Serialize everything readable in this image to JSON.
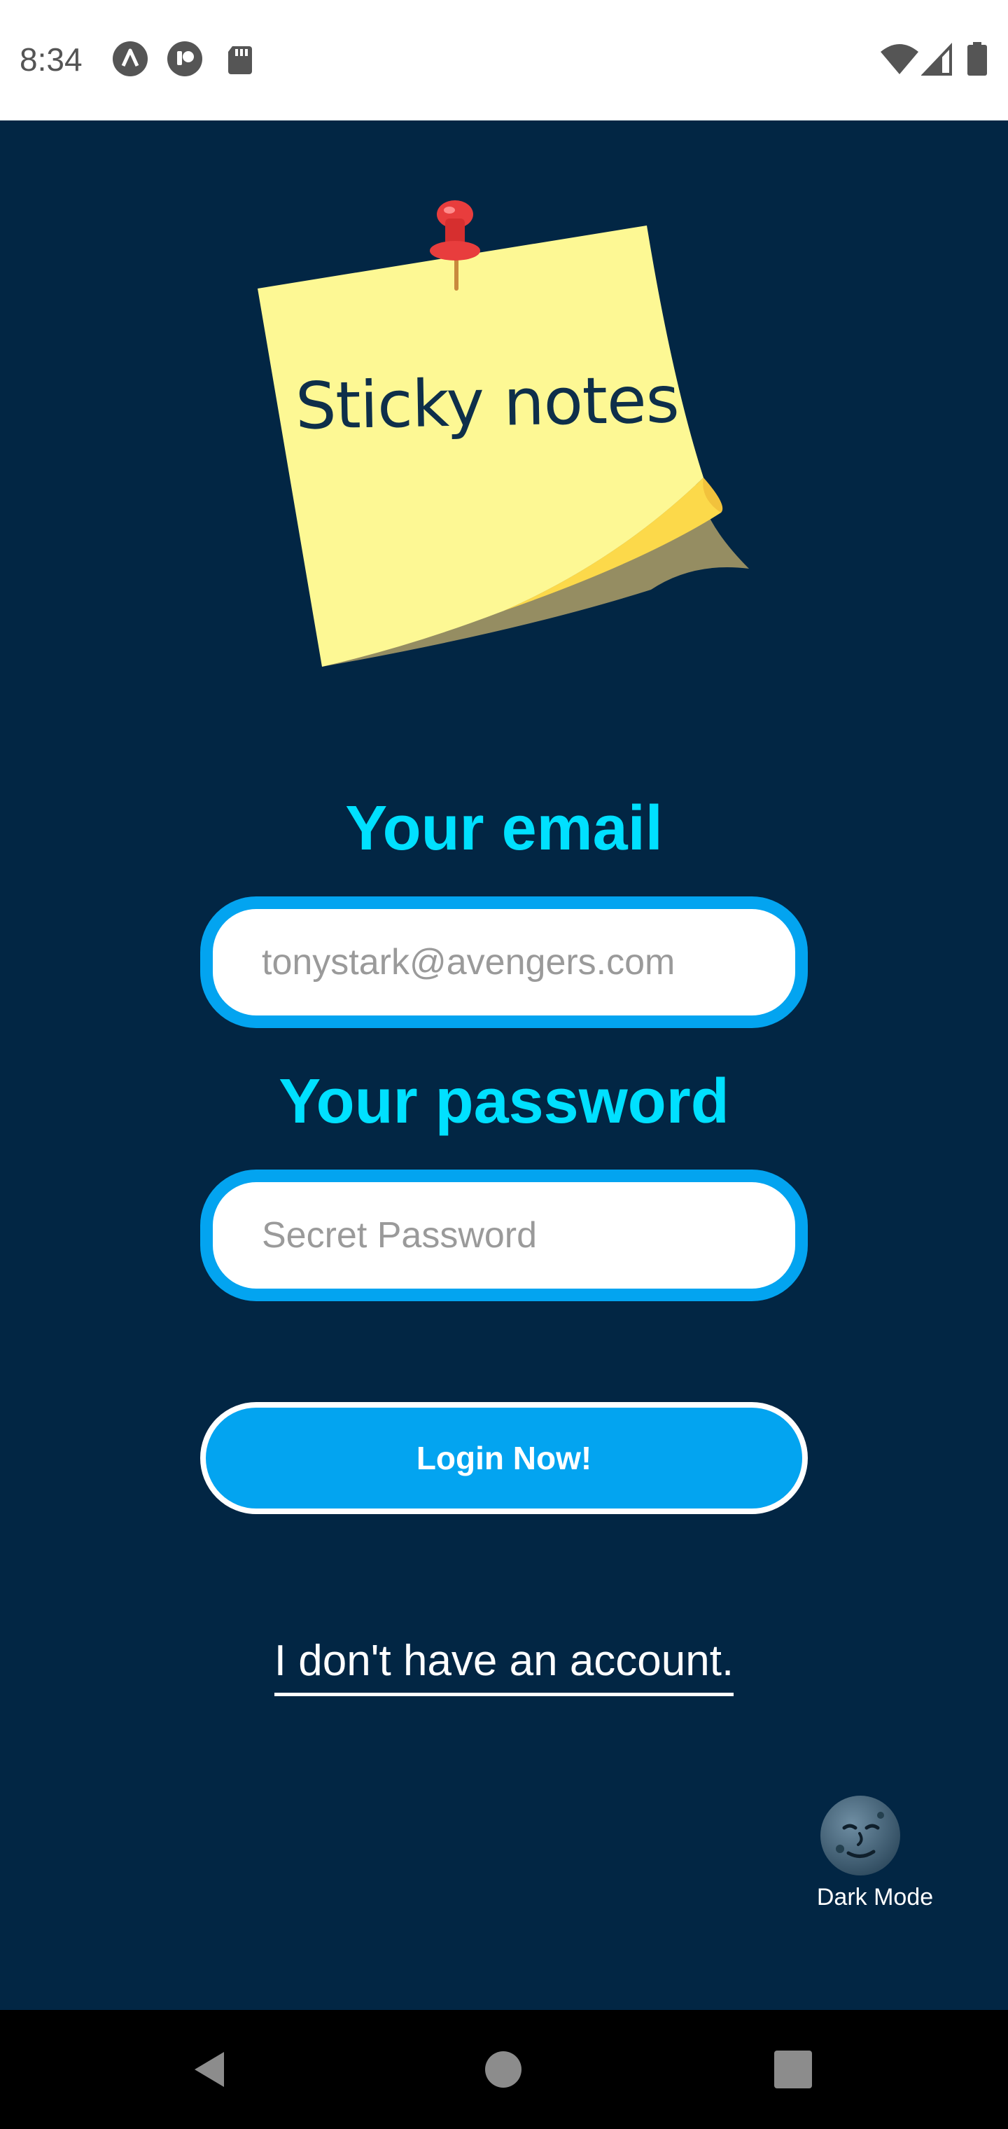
{
  "status_bar": {
    "time": "8:34",
    "left_icons": [
      "autofill-icon",
      "trace-icon",
      "sd-card-icon"
    ],
    "right_icons": [
      "wifi-icon",
      "signal-icon",
      "battery-icon"
    ]
  },
  "logo": {
    "title": "Sticky notes",
    "icon": "pushpin-icon",
    "note_color": "#fdf894"
  },
  "form": {
    "email_label": "Your email",
    "email_placeholder": "tonystark@avengers.com",
    "email_value": "",
    "password_label": "Your password",
    "password_placeholder": "Secret Password",
    "password_value": "",
    "login_label": "Login Now!",
    "signup_link": "I don't have an account."
  },
  "dark_mode": {
    "icon": "moon-face-icon",
    "label": "Dark Mode"
  },
  "nav_bar": {
    "buttons": [
      "back-icon",
      "home-icon",
      "recents-icon"
    ]
  },
  "colors": {
    "background": "#022644",
    "accent": "#03a4f0",
    "label": "#00e0ff"
  }
}
